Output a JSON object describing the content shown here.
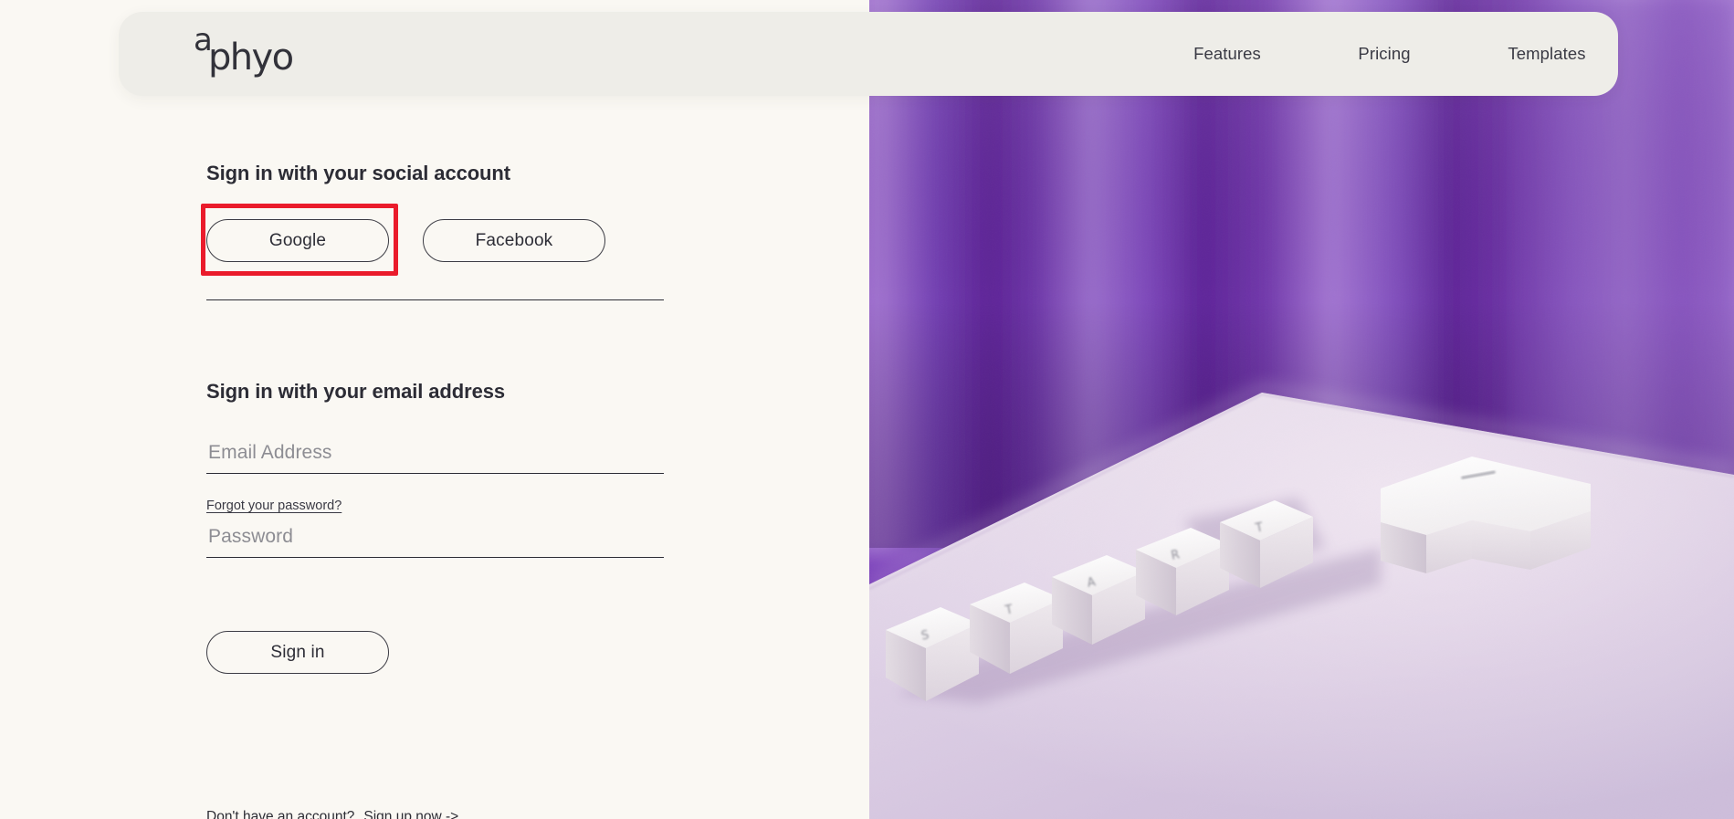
{
  "brand": {
    "logo_text": "aphyo",
    "logo_mark_letter": "a",
    "logo_word": "phyo"
  },
  "header": {
    "nav": [
      {
        "label": "Features"
      },
      {
        "label": "Pricing"
      },
      {
        "label": "Templates"
      }
    ]
  },
  "signin": {
    "social_heading": "Sign in with your social account",
    "social_buttons": [
      {
        "label": "Google",
        "highlighted": true
      },
      {
        "label": "Facebook",
        "highlighted": false
      }
    ],
    "email_heading": "Sign in with your email address",
    "email_field": {
      "value": "",
      "placeholder": "Email Address"
    },
    "password_field": {
      "value": "",
      "placeholder": "Password"
    },
    "forgot_password_label": "Forgot your password?",
    "submit_label": "Sign in",
    "no_account_text": "Don't have an account?",
    "signup_label": "Sign up now ->"
  },
  "hero": {
    "description": "Photo of white keycaps spelling START with a large enter key on a pale pink surface in front of a purple curtain backdrop",
    "keycaps": [
      "S",
      "T",
      "A",
      "R",
      "T"
    ],
    "colors": {
      "curtain_dark": "#5b2191",
      "curtain_mid": "#7a3fba",
      "curtain_light": "#9a6ecb",
      "surface_near": "#d8cbe2",
      "surface_far": "#e9dbe9",
      "keycap": "#f7f5f6"
    }
  },
  "annotation": {
    "highlight_color": "#ea1b2b",
    "target": "Google"
  },
  "theme": {
    "page_background": "#faf8f3",
    "header_card_background": "#eeede8",
    "text_primary": "#2d2d35",
    "text_placeholder": "#8d8d93"
  }
}
